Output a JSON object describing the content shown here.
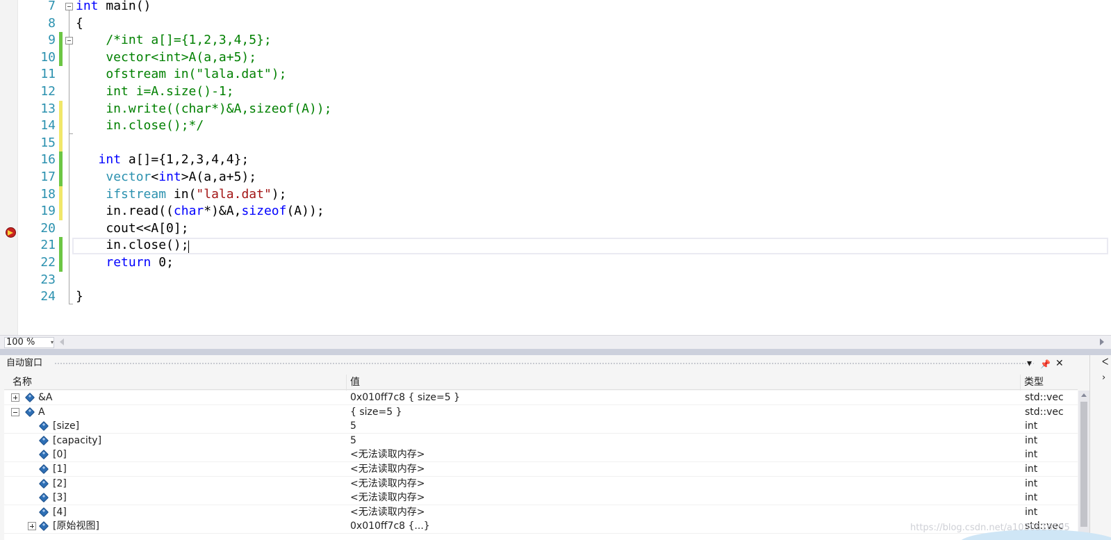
{
  "editor": {
    "lines": [
      {
        "num": "7",
        "tokens": [
          {
            "t": "int",
            "c": "kw"
          },
          {
            "t": " main()"
          }
        ]
      },
      {
        "num": "8",
        "tokens": [
          {
            "t": "{"
          }
        ]
      },
      {
        "num": "9",
        "tokens": [
          {
            "t": "    /*int a[]={1,2,3,4,5};",
            "c": "cm"
          }
        ]
      },
      {
        "num": "10",
        "tokens": [
          {
            "t": "    vector<int>A(a,a+5);",
            "c": "cm"
          }
        ]
      },
      {
        "num": "11",
        "tokens": [
          {
            "t": "    ofstream in(\"lala.dat\");",
            "c": "cm"
          }
        ]
      },
      {
        "num": "12",
        "tokens": [
          {
            "t": "    int i=A.size()-1;",
            "c": "cm"
          }
        ]
      },
      {
        "num": "13",
        "tokens": [
          {
            "t": "    in.write((char*)&A,sizeof(A));",
            "c": "cm"
          }
        ]
      },
      {
        "num": "14",
        "tokens": [
          {
            "t": "    in.close();*/",
            "c": "cm"
          }
        ]
      },
      {
        "num": "15",
        "tokens": []
      },
      {
        "num": "16",
        "tokens": [
          {
            "t": "   "
          },
          {
            "t": "int",
            "c": "kw"
          },
          {
            "t": " a[]={1,2,3,4,4};"
          }
        ]
      },
      {
        "num": "17",
        "tokens": [
          {
            "t": "    "
          },
          {
            "t": "vector",
            "c": "ty"
          },
          {
            "t": "<"
          },
          {
            "t": "int",
            "c": "kw"
          },
          {
            "t": ">A(a,a+5);"
          }
        ]
      },
      {
        "num": "18",
        "tokens": [
          {
            "t": "    "
          },
          {
            "t": "ifstream",
            "c": "ty"
          },
          {
            "t": " in("
          },
          {
            "t": "\"lala.dat\"",
            "c": "str"
          },
          {
            "t": ");"
          }
        ]
      },
      {
        "num": "19",
        "tokens": [
          {
            "t": "    in.read(("
          },
          {
            "t": "char",
            "c": "kw"
          },
          {
            "t": "*)&A,"
          },
          {
            "t": "sizeof",
            "c": "kw"
          },
          {
            "t": "(A));"
          }
        ]
      },
      {
        "num": "20",
        "tokens": [
          {
            "t": "    cout<<A[0];"
          }
        ]
      },
      {
        "num": "21",
        "tokens": [
          {
            "t": "    in.close();"
          }
        ]
      },
      {
        "num": "22",
        "tokens": [
          {
            "t": "    "
          },
          {
            "t": "return",
            "c": "kw"
          },
          {
            "t": " 0;"
          }
        ]
      },
      {
        "num": "23",
        "tokens": []
      },
      {
        "num": "24",
        "tokens": [
          {
            "t": "}"
          }
        ]
      }
    ],
    "change_marks": {
      "9": "saved",
      "10": "saved",
      "13": "unsaved",
      "14": "unsaved",
      "15": "unsaved",
      "16": "saved",
      "17": "saved",
      "18": "unsaved",
      "19": "unsaved",
      "21": "saved",
      "22": "saved"
    },
    "breakpoint_line": "20",
    "current_line": "21"
  },
  "zoom": {
    "value": "100 %",
    "arrow": "▾"
  },
  "autos": {
    "title": "自动窗口",
    "buttons": {
      "dropdown": "▾",
      "pin": "📌",
      "close": "✕"
    },
    "side_controls": [
      "ᐸ",
      "›"
    ],
    "columns": {
      "name": "名称",
      "value": "值",
      "type": "类型"
    },
    "rows": [
      {
        "name": "&A",
        "value": "0x010ff7c8 { size=5 }",
        "type": "std::vec",
        "indent": 0,
        "expander": "plus"
      },
      {
        "name": "A",
        "value": "{ size=5 }",
        "type": "std::vec",
        "indent": 0,
        "expander": "minus"
      },
      {
        "name": "[size]",
        "value": "5",
        "type": "int",
        "indent": 1,
        "expander": ""
      },
      {
        "name": "[capacity]",
        "value": "5",
        "type": "int",
        "indent": 1,
        "expander": ""
      },
      {
        "name": "[0]",
        "value": "<无法读取内存>",
        "type": "int",
        "indent": 1,
        "expander": ""
      },
      {
        "name": "[1]",
        "value": "<无法读取内存>",
        "type": "int",
        "indent": 1,
        "expander": ""
      },
      {
        "name": "[2]",
        "value": "<无法读取内存>",
        "type": "int",
        "indent": 1,
        "expander": ""
      },
      {
        "name": "[3]",
        "value": "<无法读取内存>",
        "type": "int",
        "indent": 1,
        "expander": ""
      },
      {
        "name": "[4]",
        "value": "<无法读取内存>",
        "type": "int",
        "indent": 1,
        "expander": ""
      },
      {
        "name": "[原始视图]",
        "value": "0x010ff7c8 {...}",
        "type": "std::vec",
        "indent": 1,
        "expander": "plus"
      }
    ]
  },
  "watermark": "https://blog.csdn.net/a1030516595",
  "colors": {
    "keyword": "#0000ff",
    "type": "#2b91af",
    "string": "#a31515",
    "comment": "#008000",
    "line_number": "#2b91af"
  }
}
